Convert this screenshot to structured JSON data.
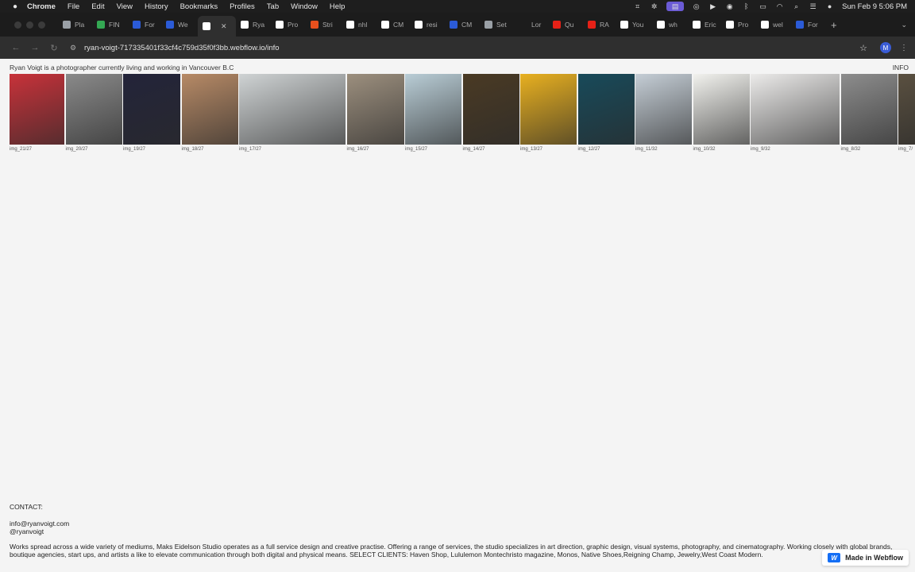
{
  "menubar": {
    "app": "Chrome",
    "items": [
      "File",
      "Edit",
      "View",
      "History",
      "Bookmarks",
      "Profiles",
      "Tab",
      "Window",
      "Help"
    ],
    "clock": "Sun Feb 9  5:06 PM"
  },
  "tabs": [
    {
      "label": "Pla",
      "color": "#9aa0a6"
    },
    {
      "label": "FIN",
      "color": "#34a853"
    },
    {
      "label": "For",
      "color": "#2b5bd7"
    },
    {
      "label": "We",
      "color": "#2b5bd7"
    },
    {
      "label": "",
      "color": "#ffffff",
      "active": true
    },
    {
      "label": "Rya",
      "color": "#ffffff"
    },
    {
      "label": "Pro",
      "color": "#ffffff"
    },
    {
      "label": "Stri",
      "color": "#e8501d"
    },
    {
      "label": "nhl",
      "color": "#ffffff"
    },
    {
      "label": "CM",
      "color": "#ffffff"
    },
    {
      "label": "resi",
      "color": "#ffffff"
    },
    {
      "label": "CM",
      "color": "#2b5bd7"
    },
    {
      "label": "Set",
      "color": "#9aa0a6"
    },
    {
      "label": "Lor",
      "color": "#1c1c1c"
    },
    {
      "label": "Qu",
      "color": "#e62117"
    },
    {
      "label": "RA",
      "color": "#e62117"
    },
    {
      "label": "You",
      "color": "#ffffff"
    },
    {
      "label": "wh",
      "color": "#ffffff"
    },
    {
      "label": "Eric",
      "color": "#ffffff"
    },
    {
      "label": "Pro",
      "color": "#ffffff"
    },
    {
      "label": "wel",
      "color": "#ffffff"
    },
    {
      "label": "For",
      "color": "#2b5bd7"
    }
  ],
  "address": {
    "url": "ryan-voigt-717335401f33cf4c759d35f0f3bb.webflow.io/info",
    "profile_initial": "M"
  },
  "page": {
    "intro": "Ryan Voigt is a photographer currently living and working in Vancouver B.C",
    "info_link": "INFO",
    "images": [
      {
        "caption": "img_21/27",
        "color": "#c8323a"
      },
      {
        "caption": "img_20/27",
        "color": "#8a8a8a"
      },
      {
        "caption": "img_19/27",
        "color": "#23243a"
      },
      {
        "caption": "img_18/27",
        "color": "#b78a66"
      },
      {
        "caption": "img_17/27",
        "color": "#cfd3d4"
      },
      {
        "caption": "img_16/27",
        "color": "#9c8f7e"
      },
      {
        "caption": "img_15/27",
        "color": "#b9cdd6"
      },
      {
        "caption": "img_14/27",
        "color": "#4a3a24"
      },
      {
        "caption": "img_13/27",
        "color": "#e8b020"
      },
      {
        "caption": "img_12/27",
        "color": "#184a5a"
      },
      {
        "caption": "img_11/32",
        "color": "#c5ced6"
      },
      {
        "caption": "img_10/32",
        "color": "#f2f2ee"
      },
      {
        "caption": "img_9/32",
        "color": "#ecebea"
      },
      {
        "caption": "img_8/32",
        "color": "#8d8d8d"
      },
      {
        "caption": "img_7/",
        "color": "#5a5040"
      }
    ],
    "contact_label": "CONTACT:",
    "email": "info@ryanvoigt.com",
    "handle": "@ryanvoigt",
    "blurb": "Works spread across a wide variety of mediums, Maks Eidelson Studio operates as a full service design and creative practise. Offering a range of services, the studio specializes in art direction, graphic design, visual systems, photography, and cinematography. Working closely with global brands, boutique agencies, start ups, and artists a like to elevate communication through both digital and physical means. SELECT CLIENTS: Haven Shop, Lululemon Montechristo magazine, Monos, Native Shoes,Reigning Champ, Jewelry,West Coast Modern."
  },
  "badge": {
    "label": "Made in Webflow",
    "logo_letter": "W"
  }
}
